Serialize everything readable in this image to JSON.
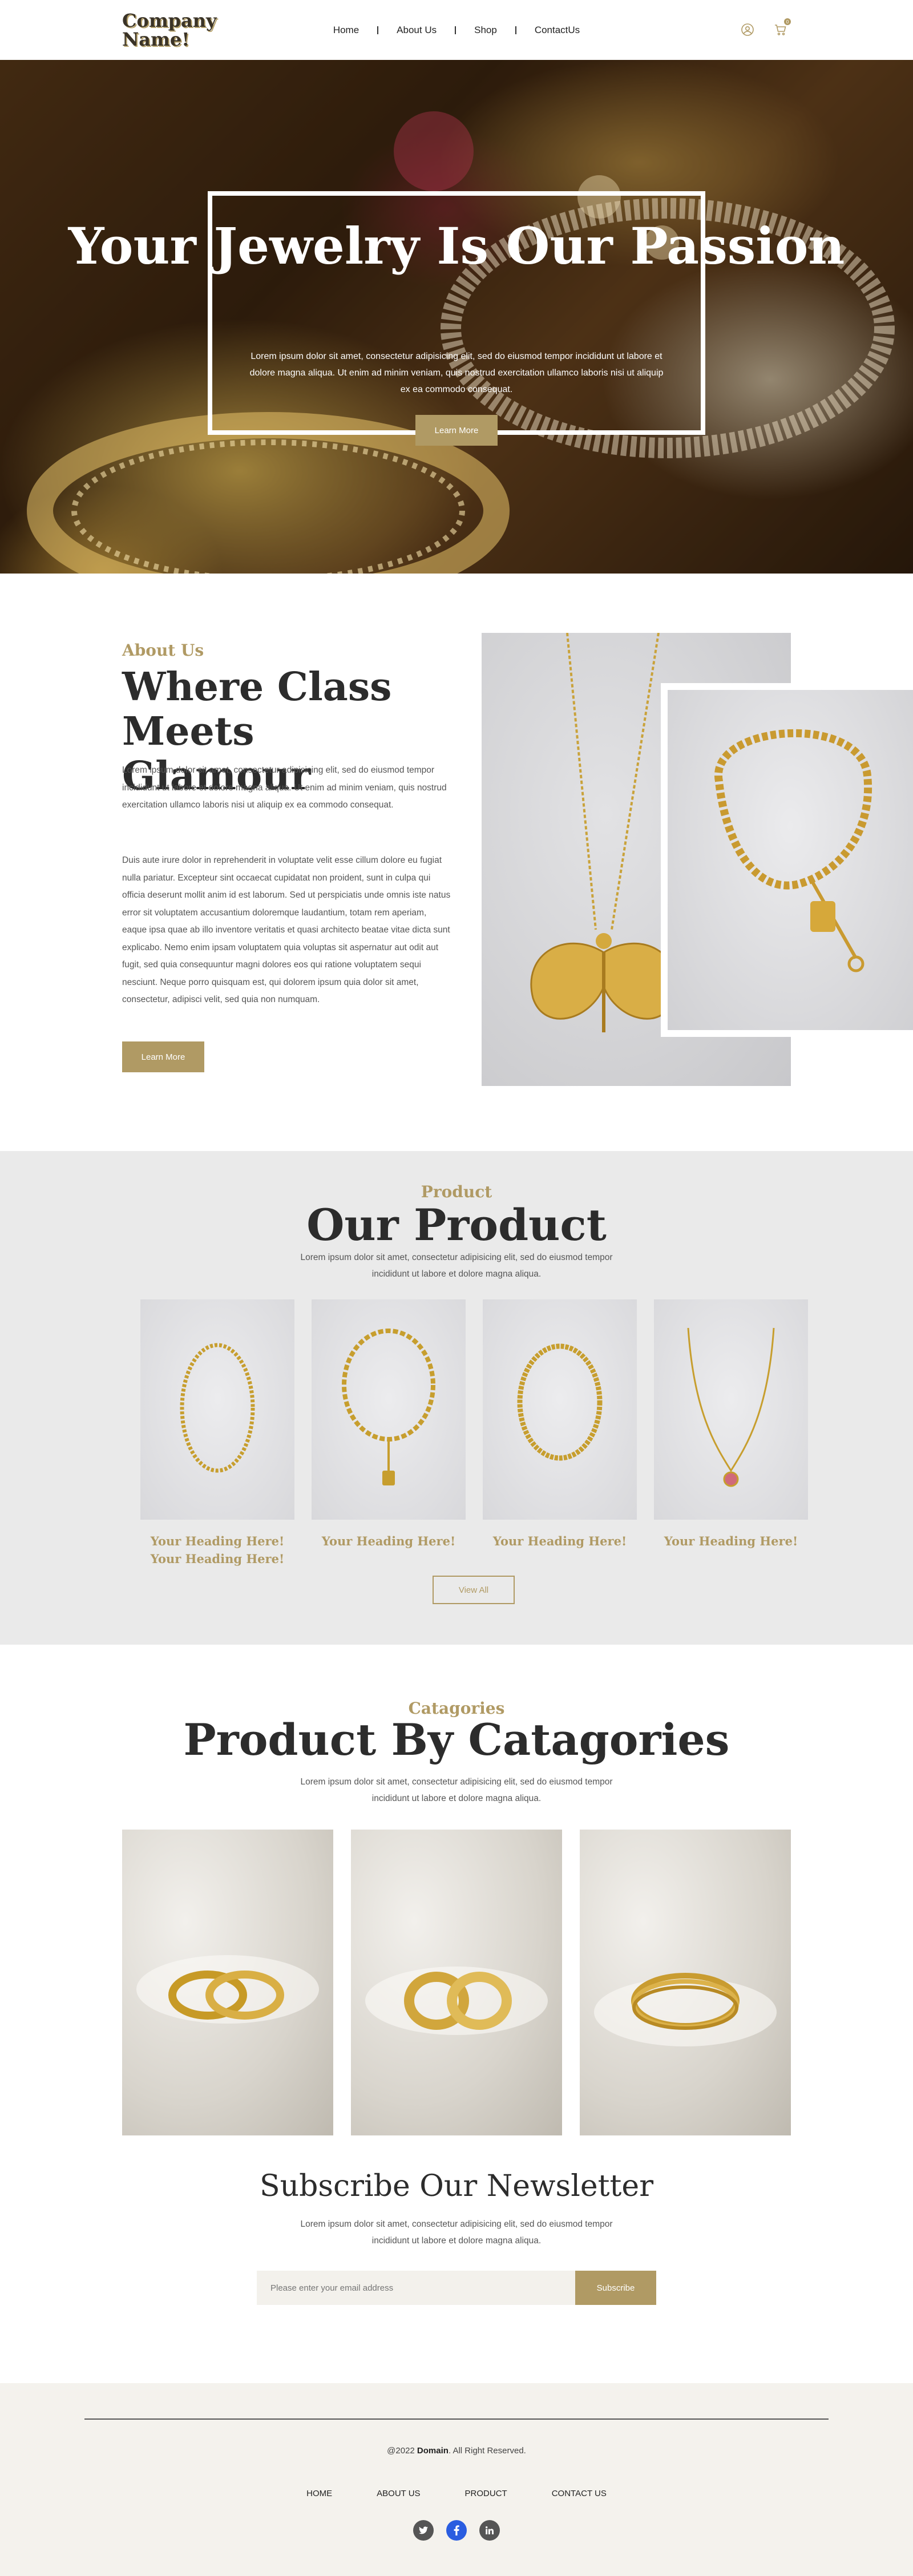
{
  "header": {
    "logo": "Company Name!",
    "nav": [
      "Home",
      "About Us",
      "Shop",
      "ContactUs"
    ],
    "cart_count": "0",
    "icons": [
      "user-icon",
      "cart-icon"
    ]
  },
  "hero": {
    "title": "Your Jewelry Is Our Passion",
    "text": "Lorem ipsum dolor sit amet, consectetur adipisicing elit, sed do eiusmod tempor incididunt ut labore et dolore magna aliqua. Ut enim ad minim veniam, quis nostrud exercitation ullamco laboris nisi ut aliquip ex ea commodo consequat.",
    "button": "Learn More"
  },
  "about": {
    "eyebrow": "About Us",
    "title": "Where Class Meets Glamour",
    "p1": "Lorem ipsum dolor sit amet, consectetur adipisicing elit, sed do eiusmod tempor incididunt ut labore et dolore magna aliqua. Ut enim ad minim veniam, quis nostrud exercitation ullamco laboris nisi ut aliquip ex ea commodo consequat.",
    "p2": "Duis aute irure dolor in reprehenderit in voluptate velit esse cillum dolore eu fugiat nulla pariatur. Excepteur sint occaecat cupidatat non proident, sunt in culpa qui officia deserunt mollit anim id est laborum. Sed ut perspiciatis unde omnis iste natus error sit voluptatem accusantium doloremque laudantium, totam rem aperiam, eaque ipsa quae ab illo inventore veritatis et quasi architecto beatae vitae dicta sunt explicabo. Nemo enim ipsam voluptatem quia voluptas sit aspernatur aut odit aut fugit, sed quia consequuntur magni dolores eos qui ratione voluptatem sequi nesciunt. Neque porro quisquam est, qui dolorem ipsum quia dolor sit amet, consectetur, adipisci velit, sed quia non numquam.",
    "button": "Learn More"
  },
  "products": {
    "eyebrow": "Product",
    "title": "Our Product",
    "sub": "Lorem ipsum dolor sit amet, consectetur adipisicing elit, sed do eiusmod tempor incididunt ut labore et dolore magna aliqua.",
    "items": [
      {
        "title": "Your Heading Here! Your Heading Here!"
      },
      {
        "title": "Your Heading Here!"
      },
      {
        "title": "Your Heading Here!"
      },
      {
        "title": "Your Heading Here!"
      }
    ],
    "button": "View All"
  },
  "categories": {
    "eyebrow": "Catagories",
    "title": "Product By Catagories",
    "sub": "Lorem ipsum dolor sit amet, consectetur adipisicing elit, sed do eiusmod tempor incididunt ut labore et dolore magna aliqua."
  },
  "newsletter": {
    "title": "Subscribe Our Newsletter",
    "sub": "Lorem ipsum dolor sit amet, consectetur adipisicing elit, sed do eiusmod tempor incididunt ut labore et dolore magna aliqua.",
    "placeholder": "Please enter your email address",
    "button": "Subscribe"
  },
  "footer": {
    "copyright_prefix": "@2022 ",
    "copyright_domain": "Domain",
    "copyright_suffix": ". All Right Reserved.",
    "nav": [
      "HOME",
      "ABOUT US",
      "PRODUCT",
      "CONTACT US"
    ],
    "social": [
      "twitter-icon",
      "facebook-icon",
      "linkedin-icon"
    ]
  },
  "colors": {
    "accent": "#b09a64",
    "dark": "#2c2c2c",
    "footer_bg": "#f4f2ed",
    "section_bg": "#eaeaea"
  }
}
